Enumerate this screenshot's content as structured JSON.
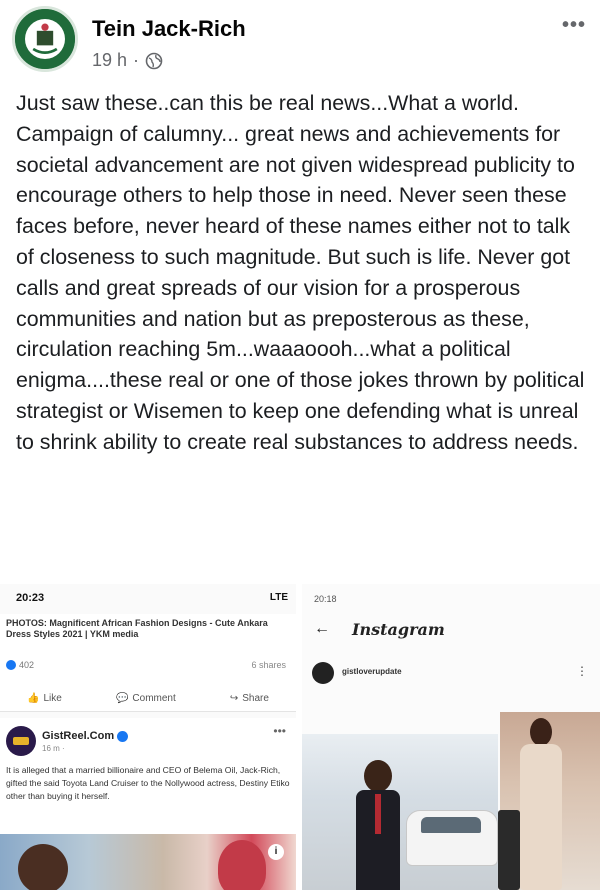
{
  "post": {
    "author": "Tein Jack-Rich",
    "time": "19 h",
    "separator": "·",
    "more": "•••",
    "text": "Just saw these..can this be real news...What a world. Campaign of calumny... great news and achievements for societal advancement are not given widespread publicity to encourage others to help those in need. Never seen these faces before, never heard of these names either not to talk of closeness to such magnitude. But such is life. Never got calls and great spreads of our vision for a prosperous communities and nation but as preposterous as these, circulation reaching 5m...waaaoooh...what a political enigma....these real or one of those jokes thrown by political strategist or Wisemen to keep one defending what is unreal to shrink ability to create real substances to address needs."
  },
  "screenshot_left": {
    "status_time": "20:23",
    "status_right": "LTE",
    "link_title": "PHOTOS: Magnificent African Fashion Designs - Cute Ankara Dress Styles 2021 | YKM media",
    "reactions": "402",
    "shares": "6 shares",
    "like": "Like",
    "comment": "Comment",
    "share": "Share",
    "page_name": "GistReel.Com",
    "page_time": "16 m · ",
    "page_more": "•••",
    "page_text": "It is alleged that a married billionaire and CEO of Belema Oil, Jack-Rich, gifted the said Toyota Land Cruiser to the Nollywood actress, Destiny Etiko other than buying it herself.",
    "info": "i"
  },
  "screenshot_right": {
    "status_time": "20:18",
    "app_name": "Instagram",
    "back": "←",
    "username": "gistloverupdate",
    "more": "⋮"
  }
}
